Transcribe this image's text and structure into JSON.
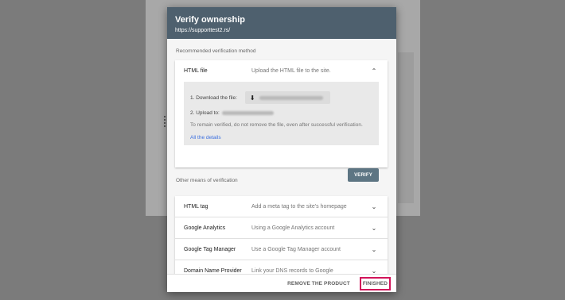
{
  "dialog": {
    "title": "Verify ownership",
    "subtitle": "https://supporttest2.rs/"
  },
  "recommended": {
    "section_label": "Recommended verification method",
    "method_name": "HTML file",
    "method_desc": "Upload the HTML file to the site.",
    "step1_label": "1. Download the file:",
    "step2_label": "2. Upload to:",
    "remain_text": "To remain verified, do not remove the file, even after successful verification.",
    "details_link": "All the details",
    "verify_label": "VERIFY"
  },
  "other": {
    "section_label": "Other means of verification",
    "methods": [
      {
        "name": "HTML tag",
        "desc": "Add a meta tag to the site's homepage"
      },
      {
        "name": "Google Analytics",
        "desc": "Using a Google Analytics account"
      },
      {
        "name": "Google Tag Manager",
        "desc": "Use a Google Tag Manager account"
      },
      {
        "name": "Domain Name Provider",
        "desc": "Link your DNS records to Google"
      }
    ]
  },
  "footer": {
    "remove_label": "REMOVE THE PRODUCT",
    "finished_label": "FINISHED"
  },
  "colors": {
    "header_bg": "#4e606e",
    "verify_bg": "#5d7583",
    "link": "#3b6fe0",
    "highlight_border": "#d2145a"
  }
}
